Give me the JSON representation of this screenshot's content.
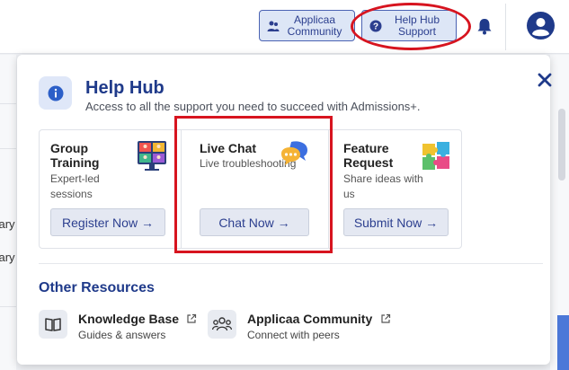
{
  "header": {
    "community_button": "Applicaa Community",
    "help_button": "Help Hub Support",
    "icons": {
      "community": "people-icon",
      "help": "question-icon",
      "bell": "bell-icon",
      "avatar": "user-avatar-icon"
    }
  },
  "background": {
    "row_text_1": "sary",
    "row_text_2": "sary"
  },
  "panel": {
    "title": "Help Hub",
    "subtitle": "Access to all the support you need to succeed with Admissions+.",
    "cards": [
      {
        "title": "Group Training",
        "description": "Expert-led sessions",
        "button": "Register Now →",
        "icon": "video-conference-icon"
      },
      {
        "title": "Live Chat",
        "description": "Live troubleshooting",
        "button": "Chat Now →",
        "icon": "chat-bubbles-icon"
      },
      {
        "title": "Feature Request",
        "description": "Share ideas with us",
        "button": "Submit Now →",
        "icon": "puzzle-icon"
      }
    ],
    "other_resources": {
      "heading": "Other Resources",
      "items": [
        {
          "title": "Knowledge Base",
          "subtitle": "Guides & answers",
          "icon": "book-icon"
        },
        {
          "title": "Applicaa Community",
          "subtitle": "Connect with peers",
          "icon": "people-icon"
        }
      ]
    }
  },
  "colors": {
    "accent": "#1f3a8a",
    "annotation": "#d7141f",
    "button_bg": "#dde6f6"
  }
}
